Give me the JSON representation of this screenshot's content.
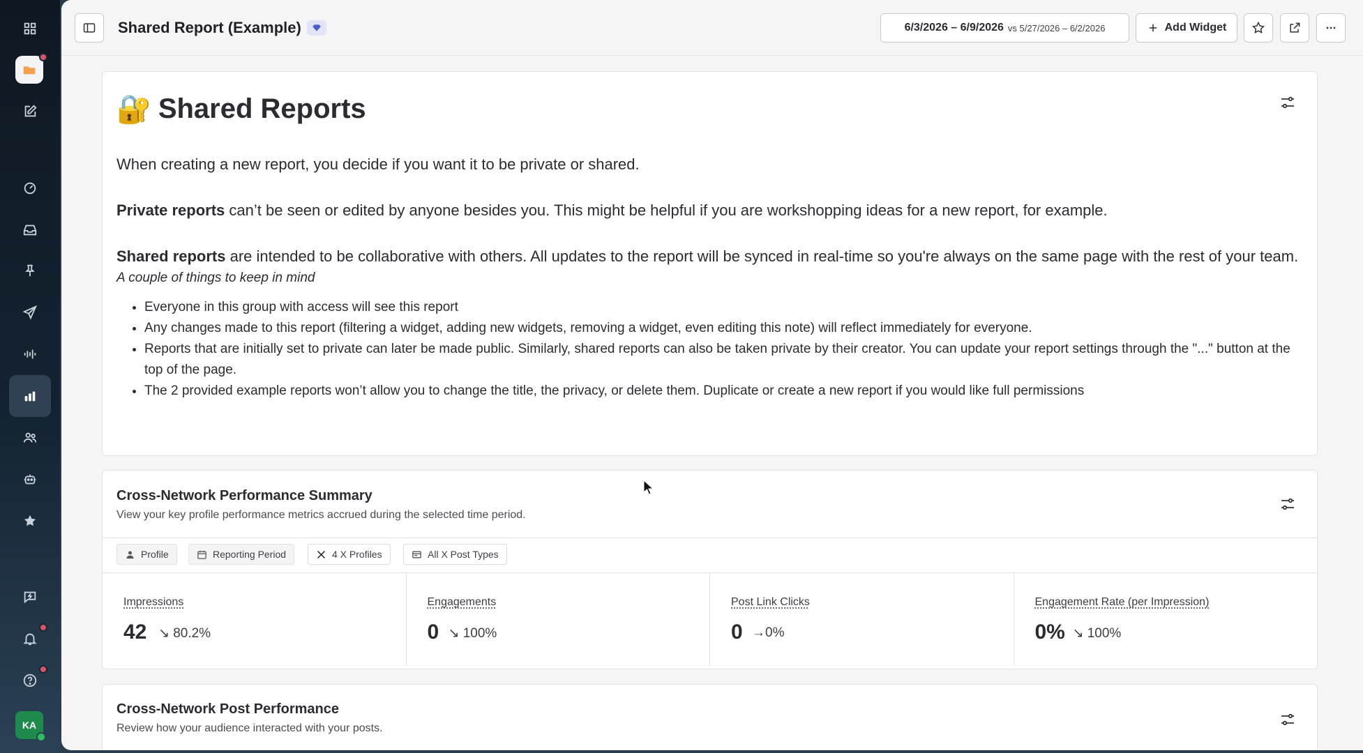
{
  "header": {
    "title": "Shared Report (Example)",
    "date_range": "6/3/2026 – 6/9/2026",
    "compare_range": "vs 5/27/2026 – 6/2/2026",
    "add_widget_label": "Add Widget"
  },
  "note": {
    "emoji": "🔐",
    "title": "Shared Reports",
    "intro": "When creating a new report, you decide if you want it to be private or shared.",
    "private_bold": "Private reports",
    "private_text": " can’t be seen or edited by anyone besides you. This might be helpful if you are workshopping ideas for a new report, for example.",
    "shared_bold": "Shared reports",
    "shared_text": " are intended to be collaborative with others. All updates to the report will be synced in real-time so you're always on the same page with the rest of your team.",
    "keep_in_mind": "A couple of things to keep in mind",
    "bullets": [
      "Everyone in this group with access will see this report",
      "Any changes made to this report (filtering a widget, adding new widgets, removing a widget, even editing this note) will reflect immediately for everyone.",
      "Reports that are initially set to private can later be made public. Similarly, shared reports can also be taken private by their creator. You can update your report settings through the \"...\" button at the top of the page.",
      "The 2 provided example reports won’t allow you to change the title, the privacy, or delete them. Duplicate or create a new report if you would like full permissions"
    ]
  },
  "summary": {
    "title": "Cross-Network Performance Summary",
    "subtitle": "View your key profile performance metrics accrued during the selected time period.",
    "chips": [
      "Profile",
      "Reporting Period",
      "4 X Profiles",
      "All X Post Types"
    ],
    "metrics": [
      {
        "label": "Impressions",
        "value": "42",
        "change_arrow": "↘",
        "change": "80.2%"
      },
      {
        "label": "Engagements",
        "value": "0",
        "change_arrow": "↘",
        "change": "100%"
      },
      {
        "label": "Post Link Clicks",
        "value": "0",
        "change_arrow": "→",
        "change": "0%"
      },
      {
        "label": "Engagement Rate (per Impression)",
        "value": "0%",
        "change_arrow": "↘",
        "change": "100%"
      }
    ]
  },
  "post_perf": {
    "title": "Cross-Network Post Performance",
    "subtitle": "Review how your audience interacted with your posts."
  },
  "user": {
    "initials": "KA"
  },
  "colors": {
    "rail": "#142331",
    "notif": "#d8546a",
    "avatar": "#1e8a4c",
    "gem": "#4b5fc9"
  }
}
